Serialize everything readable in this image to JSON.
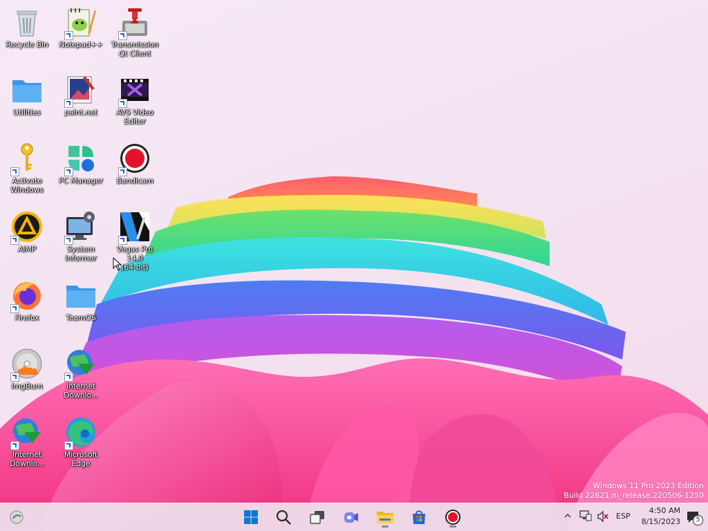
{
  "desktop": {
    "icons": [
      {
        "label": "Recycle Bin",
        "icon": "recycle-bin-icon",
        "shortcut": false
      },
      {
        "label": "Notepad++",
        "icon": "notepad-plus-plus-icon",
        "shortcut": true
      },
      {
        "label": "Transmission\nQt Client",
        "icon": "transmission-icon",
        "shortcut": true
      },
      {
        "label": "Utilities",
        "icon": "folder-icon",
        "shortcut": false
      },
      {
        "label": "paint.net",
        "icon": "paintnet-icon",
        "shortcut": true
      },
      {
        "label": "AVS Video\nEditor",
        "icon": "avs-video-editor-icon",
        "shortcut": true
      },
      {
        "label": "Activate\nWindows",
        "icon": "key-icon",
        "shortcut": true
      },
      {
        "label": "PC Manager",
        "icon": "pc-manager-icon",
        "shortcut": true
      },
      {
        "label": "Bandicam",
        "icon": "bandicam-icon",
        "shortcut": true
      },
      {
        "label": "AIMP",
        "icon": "aimp-icon",
        "shortcut": true
      },
      {
        "label": "System\nInformer",
        "icon": "system-informer-icon",
        "shortcut": true
      },
      {
        "label": "Vegas Pro 14.0\n(64-bit)",
        "icon": "vegas-pro-icon",
        "shortcut": true
      },
      {
        "label": "Firefox",
        "icon": "firefox-icon",
        "shortcut": true
      },
      {
        "label": "TeamOS",
        "icon": "folder-icon",
        "shortcut": false
      },
      {
        "label": "ImgBurn",
        "icon": "imgburn-icon",
        "shortcut": true
      },
      {
        "label": "Internet\nDownlo...",
        "icon": "internet-download-manager-icon",
        "shortcut": true
      },
      {
        "label": "Internet\nDownlo...",
        "icon": "internet-download-manager-icon",
        "shortcut": true
      },
      {
        "label": "Microsoft\nEdge",
        "icon": "edge-icon",
        "shortcut": true
      }
    ]
  },
  "watermark": {
    "line1": "Windows 11 Pro 2023 Edition",
    "line2": "Build 22621.ni_release.220506-1250"
  },
  "taskbar": {
    "buttons": [
      {
        "name": "start-button",
        "icon": "windows-logo-icon"
      },
      {
        "name": "search-button",
        "icon": "search-icon"
      },
      {
        "name": "task-view-button",
        "icon": "task-view-icon"
      },
      {
        "name": "teams-chat-button",
        "icon": "teams-icon"
      },
      {
        "name": "file-explorer-button",
        "icon": "file-explorer-icon"
      },
      {
        "name": "microsoft-store-button",
        "icon": "store-icon"
      },
      {
        "name": "bandicam-taskbar-button",
        "icon": "bandicam-icon"
      }
    ],
    "tray": {
      "chevron_icon": "chevron-up-icon",
      "network_icon": "network-icon",
      "volume_icon": "volume-muted-icon",
      "language": "ESP",
      "time": "4:50 AM",
      "date": "8/15/2023",
      "notification_count": "5"
    }
  },
  "colors": {
    "taskbar_bg": "#eee2ee",
    "start_blue": "#0a78d7",
    "folder_blue": "#5bb1f2"
  }
}
